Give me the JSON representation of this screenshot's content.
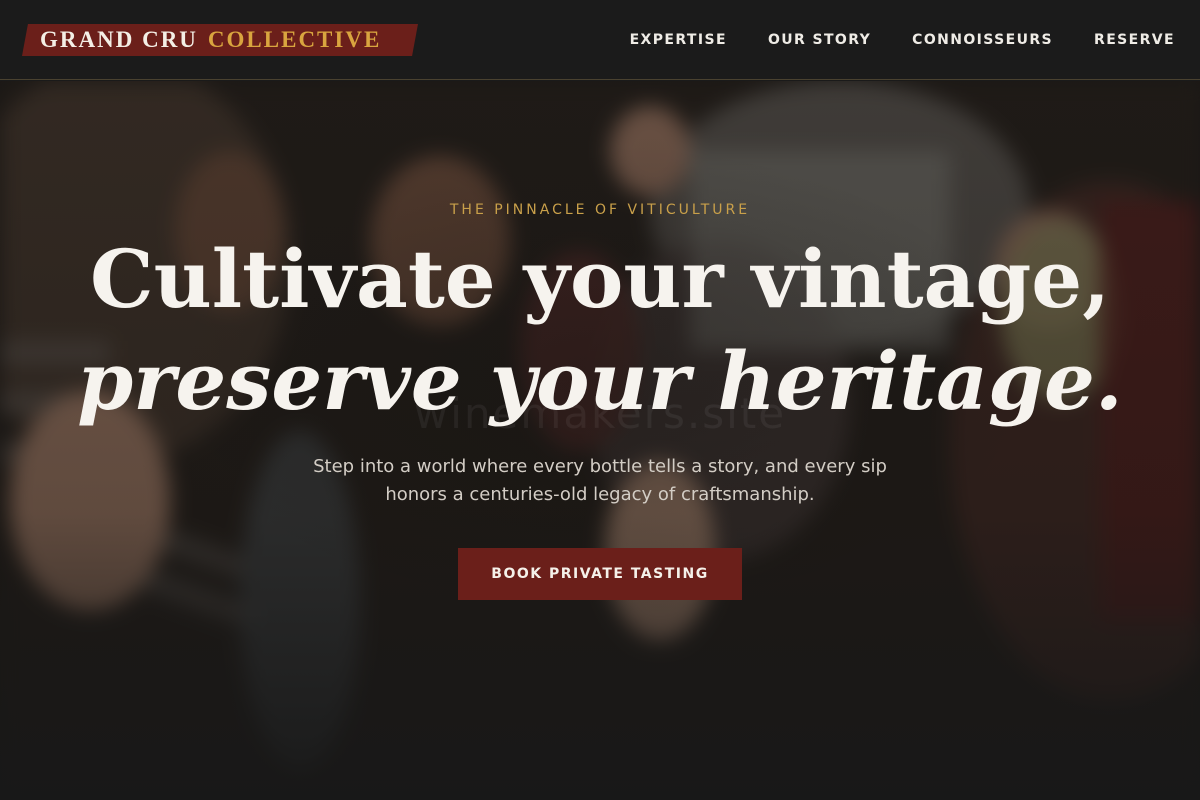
{
  "header": {
    "logo": {
      "main": "GRAND CRU",
      "accent": "COLLECTIVE"
    },
    "nav": [
      {
        "label": "EXPERTISE"
      },
      {
        "label": "OUR STORY"
      },
      {
        "label": "CONNOISSEURS"
      },
      {
        "label": "RESERVE"
      }
    ]
  },
  "hero": {
    "eyebrow": "THE PINNACLE OF VITICULTURE",
    "headline_line1": "Cultivate your vintage,",
    "headline_line2": "preserve your heritage.",
    "subtext": "Step into a world where every bottle tells a story, and every sip honors a centuries-old legacy of craftsmanship.",
    "cta_label": "BOOK PRIVATE TASTING",
    "watermark": "winemakers.site"
  },
  "colors": {
    "brand_burgundy": "#6b1f1a",
    "accent_gold": "#d9a53f",
    "header_bg": "#1b1b1b",
    "text_light": "#f6f3ee"
  }
}
